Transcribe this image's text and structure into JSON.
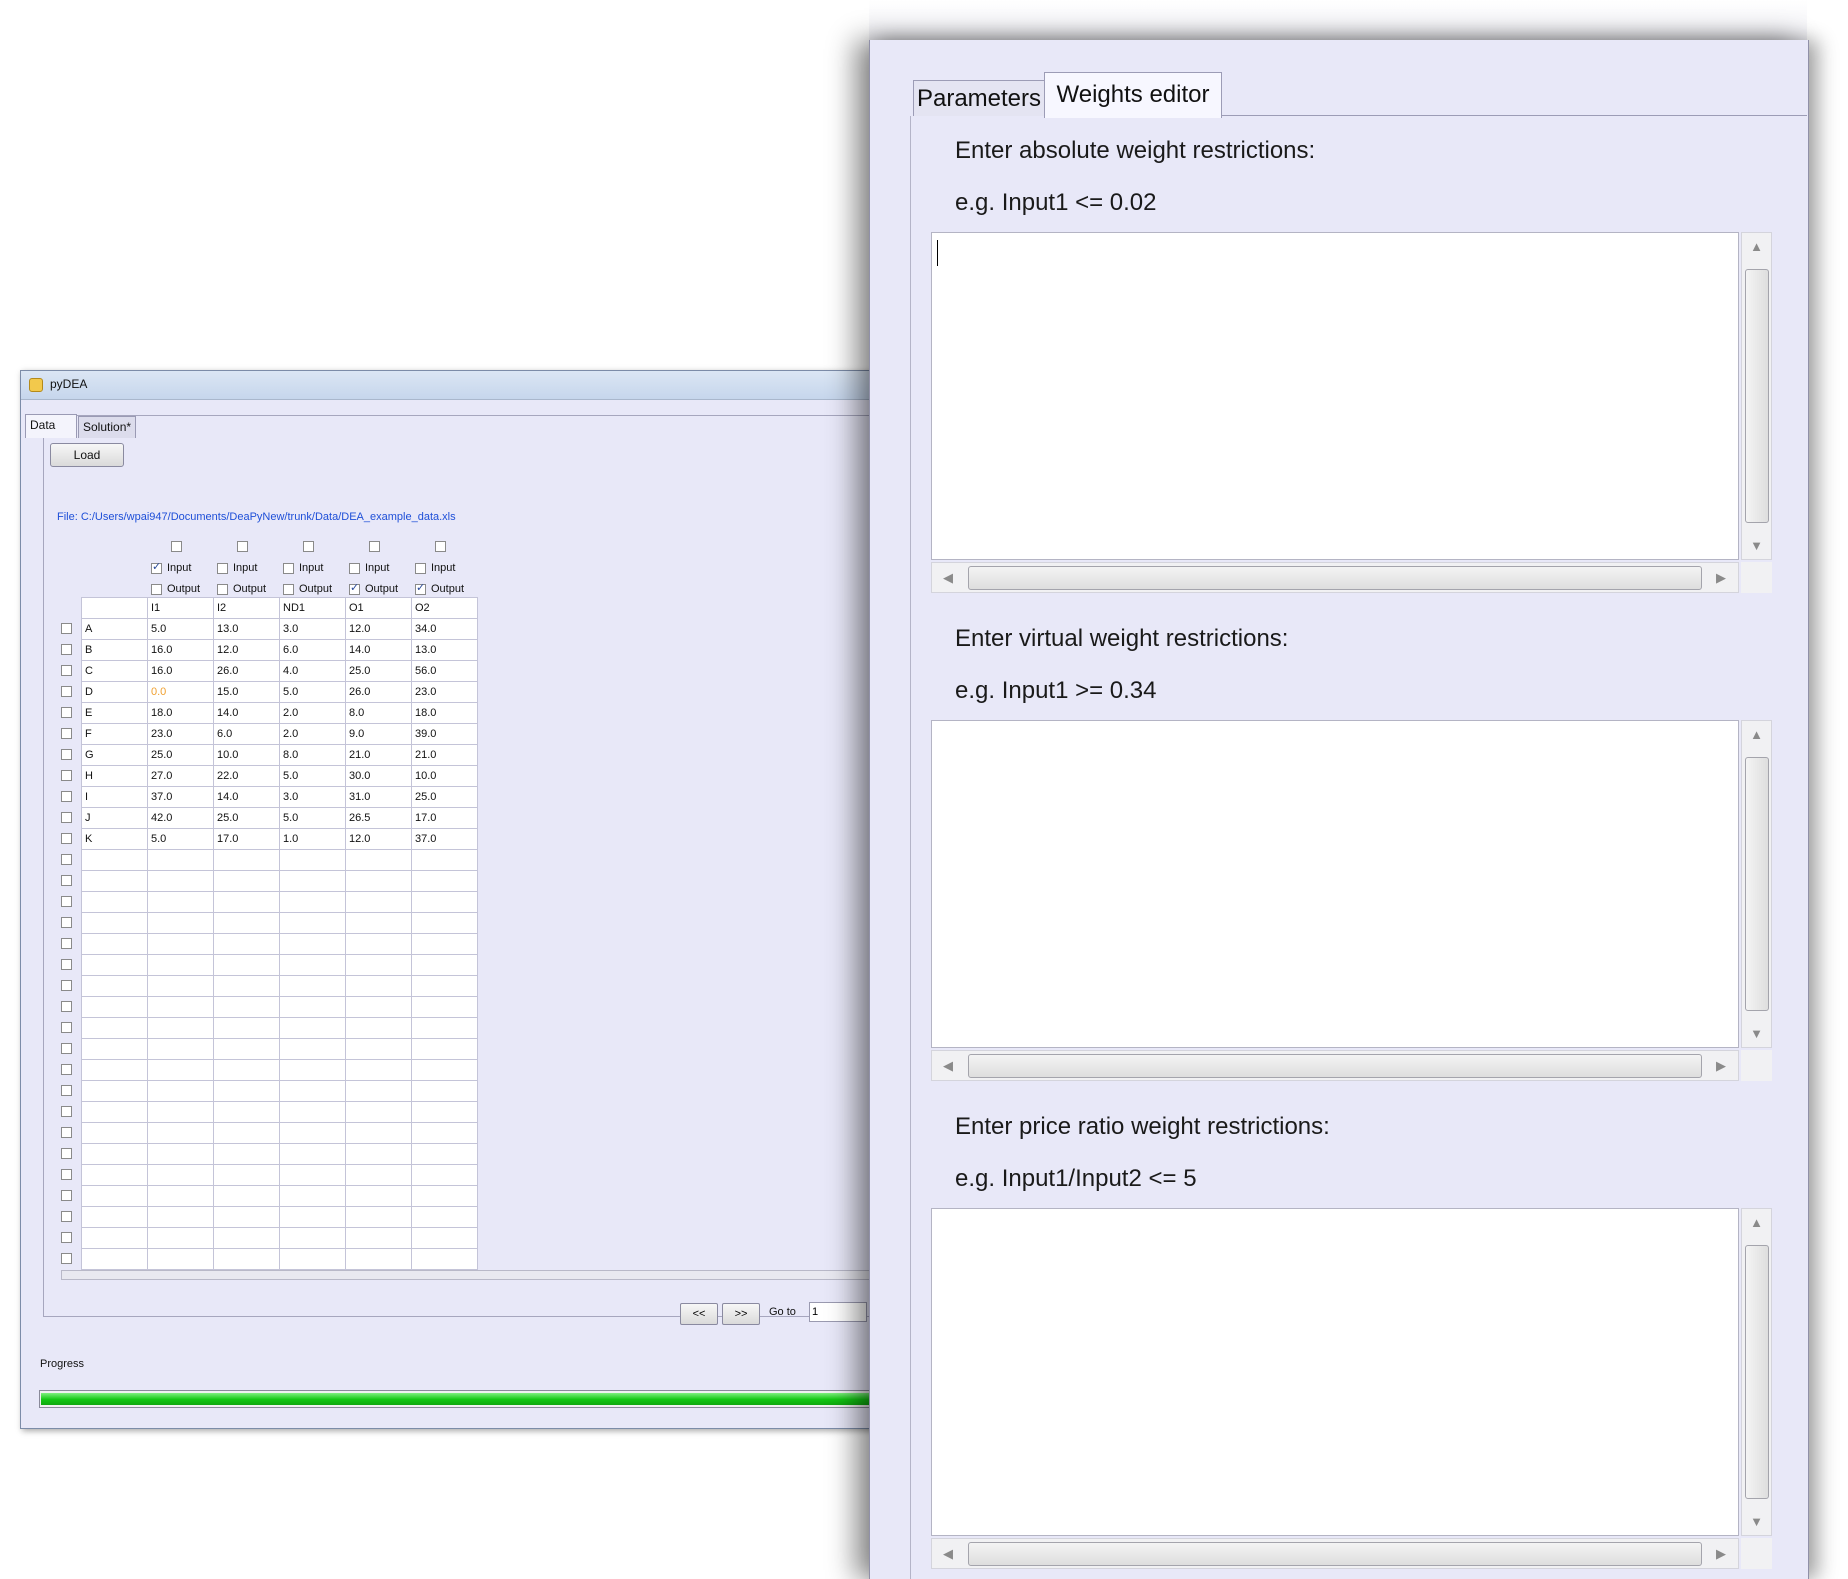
{
  "back_window": {
    "title": "pyDEA",
    "tabs": [
      "Data",
      "Solution*"
    ],
    "load_label": "Load",
    "file_path": "File: C:/Users/wpai947/Documents/DeaPyNew/trunk/Data/DEA_example_data.xls",
    "columns": [
      "I1",
      "I2",
      "ND1",
      "O1",
      "O2"
    ],
    "input_label": "Input",
    "output_label": "Output",
    "input_checked": [
      true,
      false,
      false,
      false,
      false
    ],
    "output_checked": [
      false,
      false,
      false,
      true,
      true
    ],
    "rows": [
      {
        "name": "A",
        "values": [
          "5.0",
          "13.0",
          "3.0",
          "12.0",
          "34.0"
        ]
      },
      {
        "name": "B",
        "values": [
          "16.0",
          "12.0",
          "6.0",
          "14.0",
          "13.0"
        ]
      },
      {
        "name": "C",
        "values": [
          "16.0",
          "26.0",
          "4.0",
          "25.0",
          "56.0"
        ]
      },
      {
        "name": "D",
        "values": [
          "0.0",
          "15.0",
          "5.0",
          "26.0",
          "23.0"
        ]
      },
      {
        "name": "E",
        "values": [
          "18.0",
          "14.0",
          "2.0",
          "8.0",
          "18.0"
        ]
      },
      {
        "name": "F",
        "values": [
          "23.0",
          "6.0",
          "2.0",
          "9.0",
          "39.0"
        ]
      },
      {
        "name": "G",
        "values": [
          "25.0",
          "10.0",
          "8.0",
          "21.0",
          "21.0"
        ]
      },
      {
        "name": "H",
        "values": [
          "27.0",
          "22.0",
          "5.0",
          "30.0",
          "10.0"
        ]
      },
      {
        "name": "I",
        "values": [
          "37.0",
          "14.0",
          "3.0",
          "31.0",
          "25.0"
        ]
      },
      {
        "name": "J",
        "values": [
          "42.0",
          "25.0",
          "5.0",
          "26.5",
          "17.0"
        ]
      },
      {
        "name": "K",
        "values": [
          "5.0",
          "17.0",
          "1.0",
          "12.0",
          "37.0"
        ]
      }
    ],
    "empty_rows": 20,
    "highlight_color": "#f0a030",
    "nav_prev_label": "<<",
    "nav_next_label": ">>",
    "goto_label": "Go to",
    "goto_value": "1",
    "progress_label": "Progress",
    "progress_fraction": 1.0,
    "progress_color": "#12c612"
  },
  "weights_editor": {
    "tabs": [
      "Parameters",
      "Weights editor"
    ],
    "active_tab": "Weights editor",
    "sections": [
      {
        "label": "Enter absolute weight restrictions:",
        "example": "e.g. Input1 <= 0.02",
        "value": ""
      },
      {
        "label": "Enter virtual weight restrictions:",
        "example": "e.g. Input1 >= 0.34",
        "value": ""
      },
      {
        "label": "Enter price ratio weight restrictions:",
        "example": "e.g. Input1/Input2 <= 5",
        "value": ""
      }
    ],
    "icons": {
      "scroll_up": "▲",
      "scroll_down": "▼",
      "scroll_left": "◀",
      "scroll_right": "▶"
    }
  }
}
